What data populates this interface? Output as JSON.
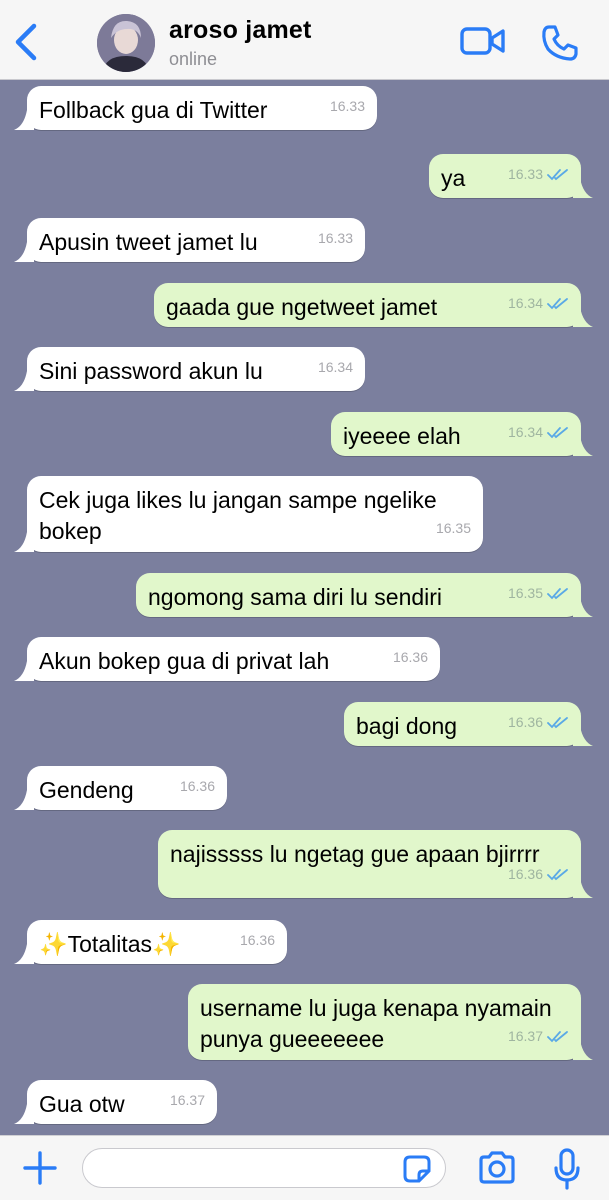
{
  "header": {
    "contact_name": "aroso jamet",
    "status": "online",
    "icons": {
      "back": "chevron-left-icon",
      "video": "video-camera-icon",
      "call": "phone-icon"
    }
  },
  "colors": {
    "accent": "#2a7cf6",
    "chat_background": "#7b7f9e",
    "incoming_bubble": "#ffffff",
    "outgoing_bubble": "#e1f7cb",
    "read_ticks": "#5aa9e6"
  },
  "messages": [
    {
      "dir": "in",
      "text": "Follback gua di Twitter",
      "time": "16.33"
    },
    {
      "dir": "out",
      "text": "ya",
      "time": "16.33",
      "read": true
    },
    {
      "dir": "in",
      "text": "Apusin tweet jamet lu",
      "time": "16.33"
    },
    {
      "dir": "out",
      "text": "gaada gue ngetweet jamet",
      "time": "16.34",
      "read": true
    },
    {
      "dir": "in",
      "text": "Sini password akun lu",
      "time": "16.34"
    },
    {
      "dir": "out",
      "text": "iyeeee elah",
      "time": "16.34",
      "read": true
    },
    {
      "dir": "in",
      "text": "Cek juga likes lu jangan sampe ngelike bokep",
      "time": "16.35"
    },
    {
      "dir": "out",
      "text": "ngomong sama diri lu sendiri",
      "time": "16.35",
      "read": true
    },
    {
      "dir": "in",
      "text": "Akun bokep gua di privat lah",
      "time": "16.36"
    },
    {
      "dir": "out",
      "text": "bagi dong",
      "time": "16.36",
      "read": true
    },
    {
      "dir": "in",
      "text": "Gendeng",
      "time": "16.36"
    },
    {
      "dir": "out",
      "text": "najisssss lu ngetag gue apaan bjirrrr",
      "time": "16.36",
      "read": true
    },
    {
      "dir": "in",
      "text": "✨Totalitas✨",
      "time": "16.36"
    },
    {
      "dir": "out",
      "text": "username lu juga kenapa nyamain punya gueeeeeee",
      "time": "16.37",
      "read": true
    },
    {
      "dir": "in",
      "text": "Gua otw",
      "time": "16.37"
    }
  ],
  "composer": {
    "value": "",
    "icons": {
      "add": "plus-icon",
      "sticker": "sticker-icon",
      "camera": "camera-icon",
      "mic": "microphone-icon"
    }
  }
}
